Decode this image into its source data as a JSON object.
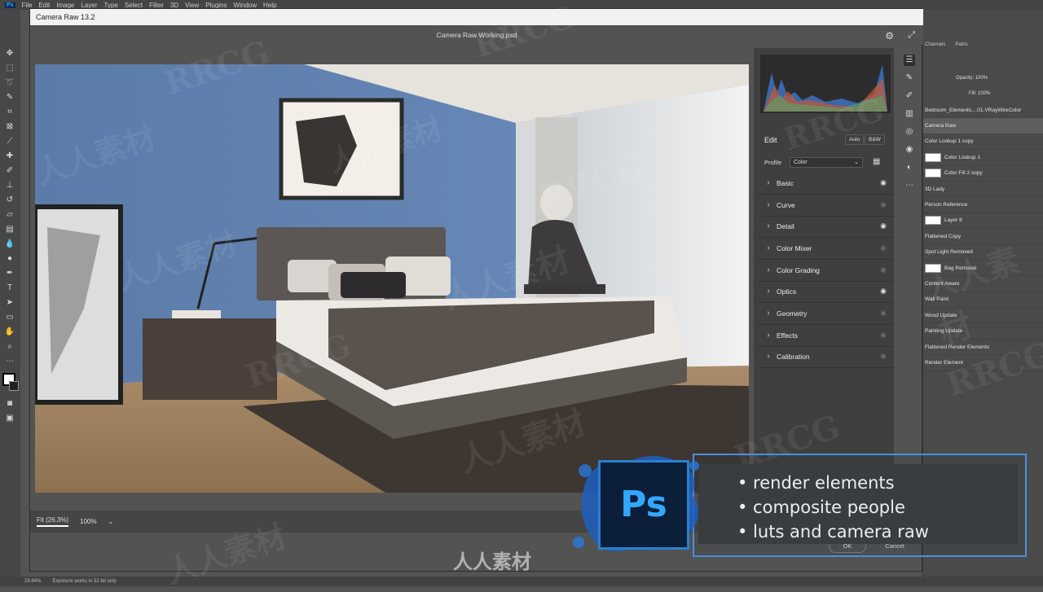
{
  "menubar": {
    "logo": "Ps",
    "items": [
      "File",
      "Edit",
      "Image",
      "Layer",
      "Type",
      "Select",
      "Filter",
      "3D",
      "View",
      "Plugins",
      "Window",
      "Help"
    ]
  },
  "camera_raw": {
    "title": "Camera Raw 13.2",
    "doc_title": "Camera Raw Working.psd",
    "edit_label": "Edit",
    "auto_label": "Auto",
    "bw_label": "B&W",
    "profile_label": "Profile",
    "profile_value": "Color",
    "sections": [
      {
        "label": "Basic",
        "visible": true
      },
      {
        "label": "Curve",
        "visible": false
      },
      {
        "label": "Detail",
        "visible": true
      },
      {
        "label": "Color Mixer",
        "visible": false
      },
      {
        "label": "Color Grading",
        "visible": false
      },
      {
        "label": "Optics",
        "visible": true
      },
      {
        "label": "Geometry",
        "visible": false
      },
      {
        "label": "Effects",
        "visible": false
      },
      {
        "label": "Calibration",
        "visible": false
      }
    ],
    "zoom_fit": "Fit (26.3%)",
    "zoom_100": "100%",
    "ok_label": "OK",
    "cancel_label": "Cancel"
  },
  "layers_panel": {
    "tabs": [
      "Channels",
      "Paths"
    ],
    "opacity_label": "Opacity:",
    "opacity_value": "100%",
    "fill_label": "Fill:",
    "fill_value": "100%",
    "layers": [
      "Bedroom_Elements....01.VRayWireColor",
      "Camera Raw",
      "Color Lookup 1 copy",
      "Color Lookup 1",
      "Color Fill 2 copy",
      "3D Lady",
      "Person Reference",
      "Layer 8",
      "Flattened Copy",
      "Spot Light Removed",
      "Bag Removal",
      "Content Aware",
      "Wall Paint",
      "Wood Update",
      "Painting Update",
      "Flattened Render Elements",
      "Render Element"
    ]
  },
  "statusbar": {
    "zoom": "29.84%",
    "info": "Exposure works in 32-bit only"
  },
  "promo": {
    "logo": "Ps",
    "bullets": [
      "• render elements",
      "• composite people",
      "• luts and camera raw"
    ]
  },
  "watermarks": [
    "RRCG",
    "人人素材"
  ],
  "brand": "人人素材",
  "colors": {
    "accent": "#31a8ff",
    "promo_border": "#4a8fe0",
    "wall": "#5d7fae"
  }
}
